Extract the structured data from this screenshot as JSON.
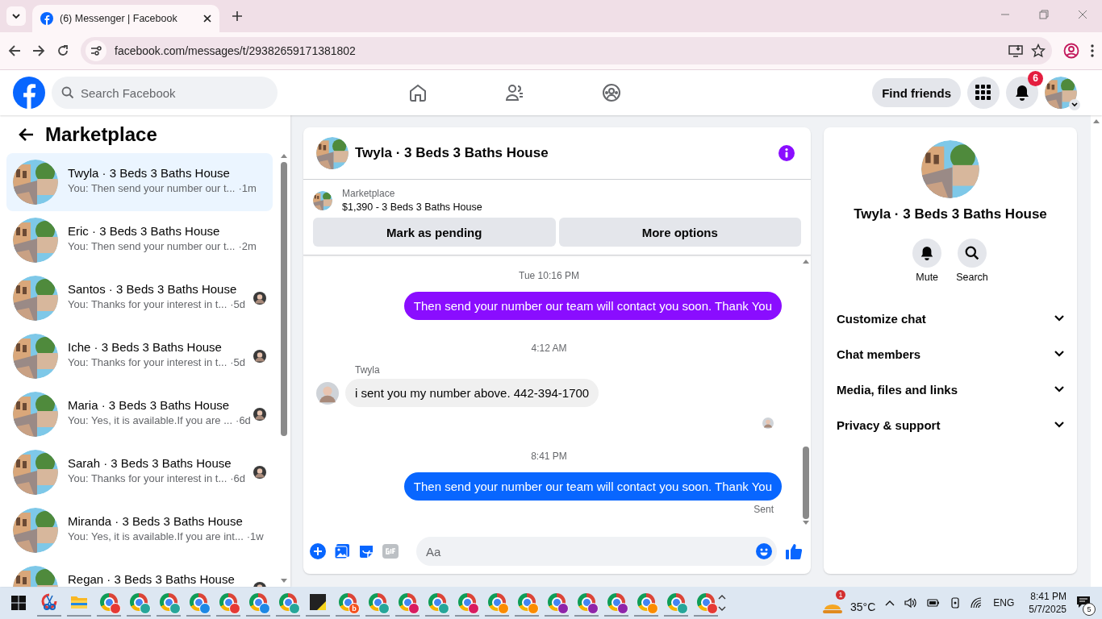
{
  "browser": {
    "tab_title": "(6) Messenger | Facebook",
    "url": "facebook.com/messages/t/29382659171381802"
  },
  "header": {
    "search_placeholder": "Search Facebook",
    "find_friends": "Find friends",
    "notification_count": "6"
  },
  "sidebar": {
    "title": "Marketplace",
    "conversations": [
      {
        "name": "Twyla · 3 Beds 3 Baths House",
        "preview": "You: Then send your number our t...",
        "time": "·1m",
        "selected": true,
        "seen": false
      },
      {
        "name": "Eric · 3 Beds 3 Baths House",
        "preview": "You: Then send your number our t...",
        "time": "·2m",
        "selected": false,
        "seen": false
      },
      {
        "name": "Santos · 3 Beds 3 Baths House",
        "preview": "You: Thanks for your interest in t...",
        "time": "·5d",
        "selected": false,
        "seen": true
      },
      {
        "name": "Iche · 3 Beds 3 Baths House",
        "preview": "You: Thanks for your interest in t...",
        "time": "·5d",
        "selected": false,
        "seen": true
      },
      {
        "name": "Maria · 3 Beds 3 Baths House",
        "preview": "You: Yes, it is available.If you are ...",
        "time": "·6d",
        "selected": false,
        "seen": true
      },
      {
        "name": "Sarah · 3 Beds 3 Baths House",
        "preview": "You: Thanks for your interest in t...",
        "time": "·6d",
        "selected": false,
        "seen": true
      },
      {
        "name": "Miranda · 3 Beds 3 Baths House",
        "preview": "You: Yes, it is available.If you are int...",
        "time": "·1w",
        "selected": false,
        "seen": false
      },
      {
        "name": "Regan · 3 Beds 3 Baths House",
        "selected": false,
        "seen": true
      }
    ]
  },
  "chat": {
    "title": "Twyla · 3 Beds 3 Baths House",
    "listing_label": "Marketplace",
    "listing": "$1,390 - 3 Beds 3 Baths House",
    "buttons": [
      "Mark as pending",
      "More options"
    ],
    "messages": [
      {
        "kind": "time",
        "text": "Tue 10:16 PM"
      },
      {
        "kind": "outgoing",
        "text": "Then send your number our team will contact you soon. Thank You",
        "color": "#8a0dff"
      },
      {
        "kind": "time",
        "text": "4:12 AM"
      },
      {
        "kind": "incoming",
        "sender": "Twyla",
        "text": "i sent you my number above. 442-394-1700"
      },
      {
        "kind": "seen"
      },
      {
        "kind": "time",
        "text": "8:41 PM"
      },
      {
        "kind": "outgoing",
        "text": "Then send your number our team will contact you soon. Thank You",
        "color": "#0866ff",
        "status": "Sent"
      }
    ],
    "composer_placeholder": "Aa"
  },
  "details": {
    "name": "Twyla · 3 Beds 3 Baths House",
    "actions": [
      {
        "kind": "bell",
        "label": "Mute"
      },
      {
        "kind": "search",
        "label": "Search"
      }
    ],
    "sections": [
      {
        "label": "Customize chat",
        "expanded": false
      },
      {
        "label": "Chat members",
        "expanded": false
      },
      {
        "label": "Media, files and links",
        "expanded": false
      },
      {
        "label": "Privacy & support",
        "expanded": false
      }
    ]
  },
  "taskbar": {
    "apps": [
      {
        "kind": "snipping"
      },
      {
        "kind": "folder"
      },
      {
        "kind": "browser",
        "color": "#e53935"
      },
      {
        "kind": "browser",
        "color": "#26a69a"
      },
      {
        "kind": "browser",
        "color": "#26a69a"
      },
      {
        "kind": "browser",
        "color": "#1e88e5"
      },
      {
        "kind": "browser",
        "color": "#e53935"
      },
      {
        "kind": "browser",
        "color": "#1e88e5"
      },
      {
        "kind": "browser",
        "color": "#26a69a"
      },
      {
        "kind": "notes"
      },
      {
        "kind": "browser",
        "color": "#f4511e",
        "badge": "b"
      },
      {
        "kind": "browser",
        "color": "#26a69a"
      },
      {
        "kind": "browser",
        "color": "#d81b60"
      },
      {
        "kind": "browser",
        "color": "#26a69a"
      },
      {
        "kind": "browser",
        "color": "#d81b60"
      },
      {
        "kind": "browser",
        "color": "#fb8c00"
      },
      {
        "kind": "browser",
        "color": "#fb8c00"
      },
      {
        "kind": "browser",
        "color": "#8e24aa"
      },
      {
        "kind": "browser",
        "color": "#8e24aa"
      },
      {
        "kind": "browser",
        "color": "#8e24aa"
      },
      {
        "kind": "browser",
        "color": "#fb8c00"
      },
      {
        "kind": "browser",
        "color": "#26a69a"
      },
      {
        "kind": "browser",
        "color": "#e53935"
      }
    ],
    "weather": {
      "temp": "35°C",
      "badge": "1"
    },
    "language": "ENG",
    "time": "8:41 PM",
    "date": "5/7/2025",
    "notifications": "5"
  }
}
